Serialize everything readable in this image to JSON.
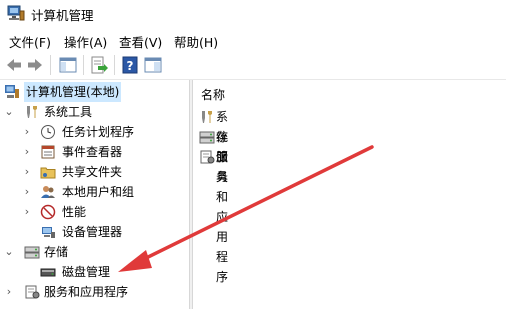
{
  "window": {
    "title": "计算机管理"
  },
  "menu": [
    "文件(F)",
    "操作(A)",
    "查看(V)",
    "帮助(H)"
  ],
  "toolbar": {
    "buttons": [
      "back-icon",
      "forward-icon",
      "show-hide-tree-icon",
      "export-list-icon",
      "help-icon",
      "properties-icon"
    ]
  },
  "tree": {
    "root": "计算机管理(本地)",
    "system_tools": "系统工具",
    "task_scheduler": "任务计划程序",
    "event_viewer": "事件查看器",
    "shared_folders": "共享文件夹",
    "local_users": "本地用户和组",
    "performance": "性能",
    "device_manager": "设备管理器",
    "storage": "存储",
    "disk_management": "磁盘管理",
    "services_apps": "服务和应用程序"
  },
  "right": {
    "column_header": "名称",
    "items": [
      "系统工具",
      "存储",
      "服务和应用程序"
    ]
  },
  "colors": {
    "arrow": "#e03a3a",
    "selection": "#cce8ff"
  }
}
